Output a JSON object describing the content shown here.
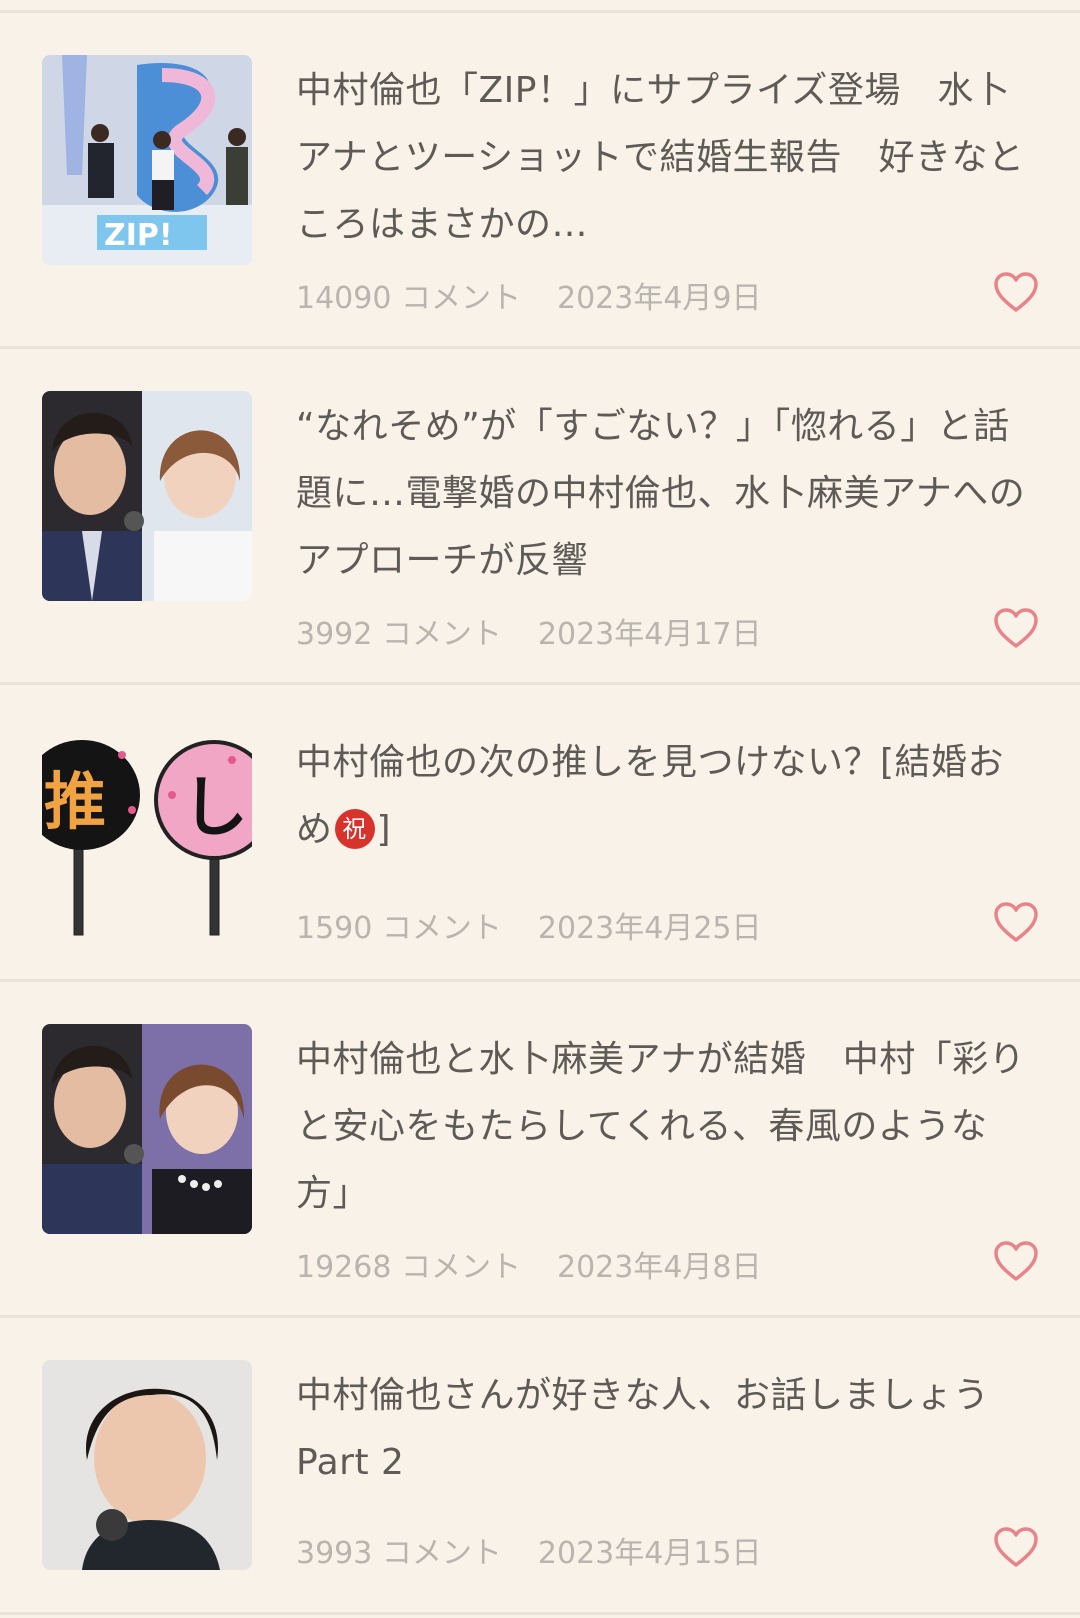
{
  "articles": [
    {
      "title": "中村倫也「ZIP！」にサプライズ登場　水卜アナとツーショットで結婚生報告　好きなところはまさかの…",
      "comments": "14090 コメント",
      "date": "2023年4月9日",
      "thumbnail_icon": "tv-studio-photo"
    },
    {
      "title": "“なれそめ”が「すごない？」「惚れる」と話題に…電撃婚の中村倫也、水卜麻美アナへのアプローチが反響",
      "comments": "3992 コメント",
      "date": "2023年4月17日",
      "thumbnail_icon": "couple-photo"
    },
    {
      "title_prefix": "中村倫也の次の推しを見つけない？[結婚おめ",
      "title_badge": "祝",
      "title_suffix": "]",
      "comments": "1590 コメント",
      "date": "2023年4月25日",
      "thumbnail_icon": "uchiwa-fan-illustration",
      "thumb_text_1": "推",
      "thumb_text_2": "し"
    },
    {
      "title": "中村倫也と水卜麻美アナが結婚　中村「彩りと安心をもたらしてくれる、春風のような方」",
      "comments": "19268 コメント",
      "date": "2023年4月8日",
      "thumbnail_icon": "couple-photo"
    },
    {
      "title": "中村倫也さんが好きな人、お話しましょう Part 2",
      "comments": "3993 コメント",
      "date": "2023年4月15日",
      "thumbnail_icon": "portrait-photo"
    }
  ],
  "colors": {
    "background": "#f8f2e8",
    "title": "#5e5a56",
    "meta": "#b9b4ae",
    "heart": "#e8838a",
    "divider": "#e9e2d9"
  },
  "heart_icon": "heart-outline-icon"
}
